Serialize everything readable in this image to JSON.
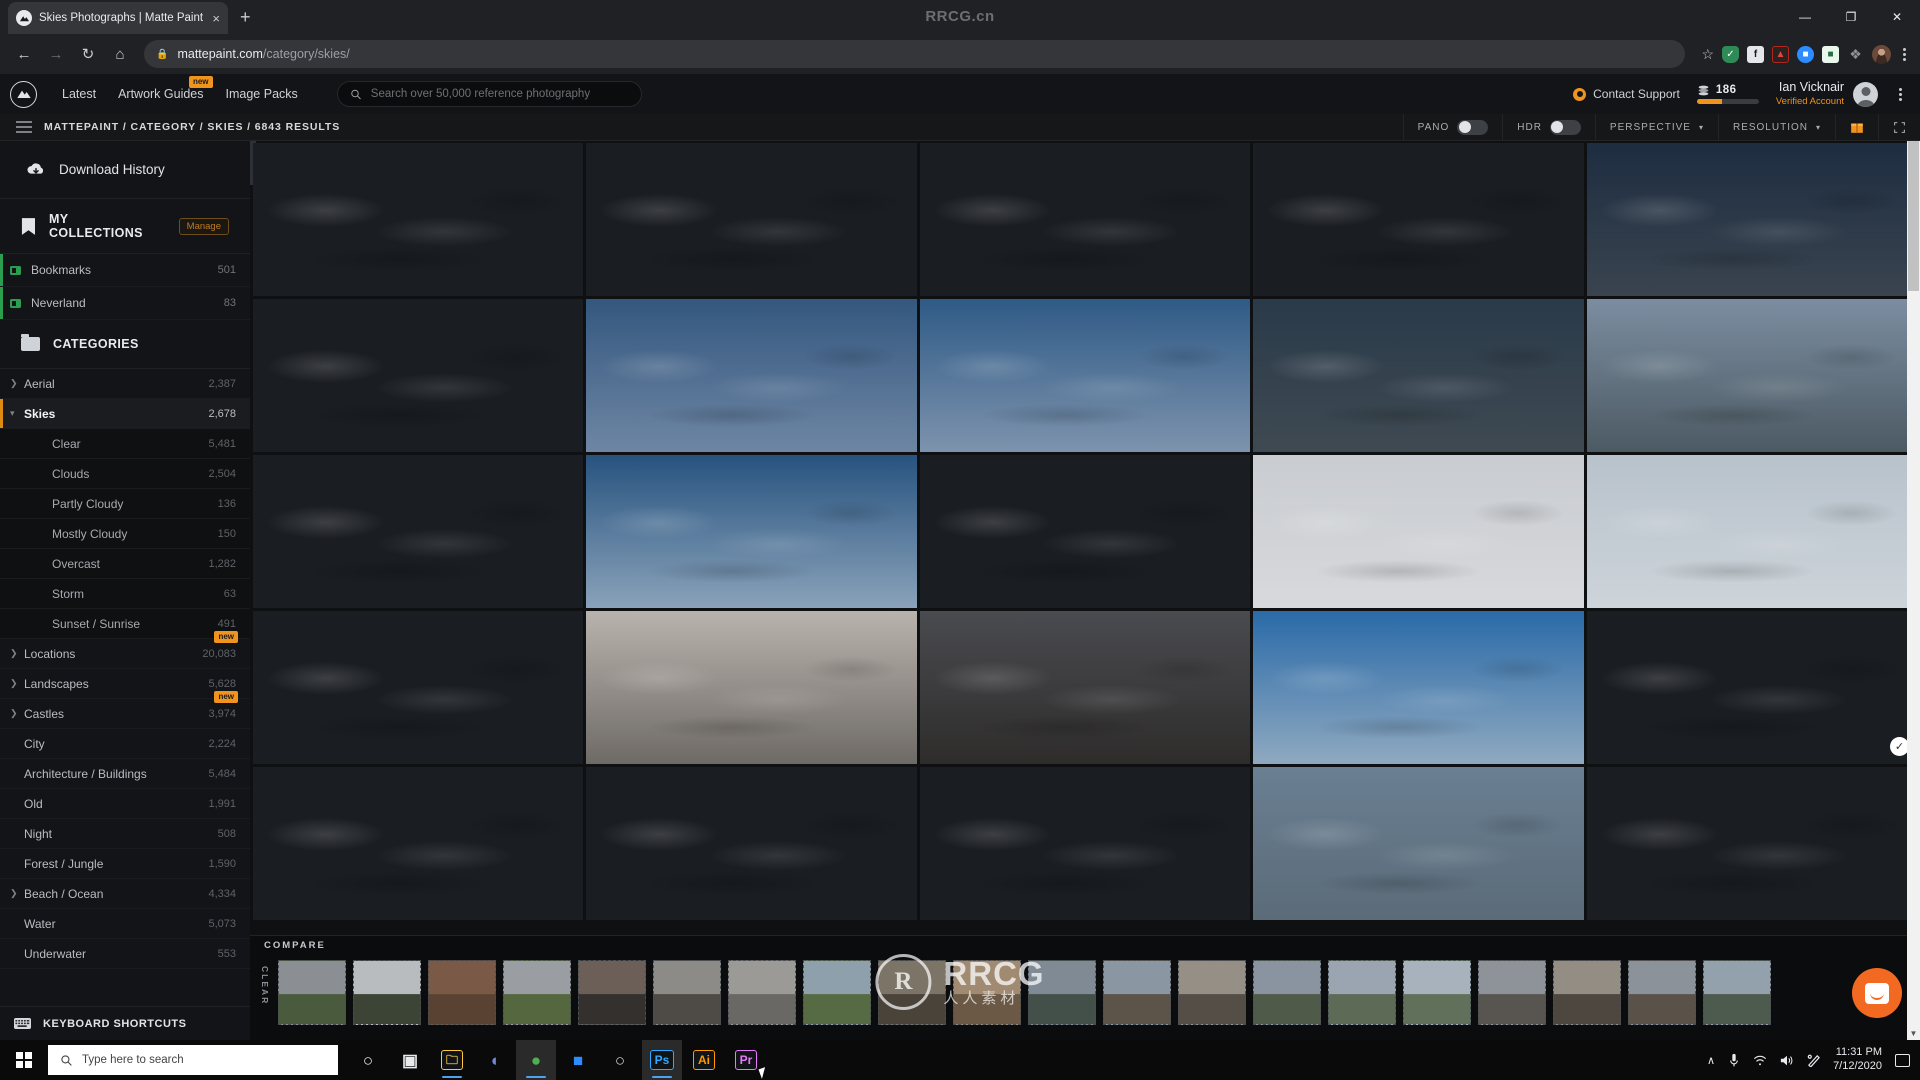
{
  "browser": {
    "tab": {
      "title": "Skies Photographs | Matte Paint",
      "favicon": "mattepaint-logo-icon",
      "close": "×"
    },
    "new_tab": "+",
    "window_watermark": "RRCG.cn",
    "window_controls": {
      "minimize": "—",
      "maximize": "❐",
      "close": "✕"
    },
    "nav": {
      "back": "←",
      "forward": "→",
      "reload": "↻",
      "home": "⌂"
    },
    "url": {
      "lock": "🔒",
      "domain": "mattepaint.com",
      "path": "/category/skies/"
    },
    "extensions": [
      {
        "name": "bookmark-star-icon",
        "glyph": "☆",
        "color": "transparent"
      },
      {
        "name": "vpn-shield-icon",
        "glyph": "✓",
        "color": "#2e8b57"
      },
      {
        "name": "facebook-icon",
        "glyph": "f",
        "color": "#e4e6eb"
      },
      {
        "name": "adobe-acrobat-icon",
        "glyph": "▲",
        "color": "#b3261e"
      },
      {
        "name": "zoom-icon",
        "glyph": "■",
        "color": "#2d8cff"
      },
      {
        "name": "evernote-icon",
        "glyph": "■",
        "color": "#e9f7ec"
      },
      {
        "name": "extensions-puzzle-icon",
        "glyph": "❖",
        "color": "#8e9196"
      },
      {
        "name": "chrome-profile-avatar",
        "glyph": "",
        "color": "#6b4a3a"
      }
    ],
    "menu": "⋮"
  },
  "site_header": {
    "logo": "mattepaint-mountain-logo",
    "nav_links": [
      {
        "label": "Latest",
        "badge": ""
      },
      {
        "label": "Artwork Guides",
        "badge": "new"
      },
      {
        "label": "Image Packs",
        "badge": ""
      }
    ],
    "search": {
      "placeholder": "Search over 50,000 reference photography",
      "value": "",
      "icon": "search-icon"
    },
    "support": {
      "label": "Contact Support",
      "icon": "lifering-icon"
    },
    "credits": {
      "count": "186",
      "icon": "credits-coins-icon",
      "progress_pct": 40
    },
    "user": {
      "name": "Ian Vicknair",
      "status": "Verified Account",
      "avatar": "user-avatar"
    },
    "more_menu": "⋮"
  },
  "toolbar": {
    "menu_icon": "hamburger-icon",
    "breadcrumb": "MATTEPAINT / CATEGORY / SKIES / 6843 RESULTS",
    "controls": [
      {
        "label": "PANO",
        "type": "toggle",
        "state": "off"
      },
      {
        "label": "HDR",
        "type": "toggle",
        "state": "off"
      },
      {
        "label": "PERSPECTIVE",
        "type": "dropdown",
        "caret": "▾"
      },
      {
        "label": "RESOLUTION",
        "type": "dropdown",
        "caret": "▾"
      }
    ],
    "gift_icon": "🎁",
    "fullscreen_icon": "⛶"
  },
  "sidebar": {
    "download_history": {
      "label": "Download History",
      "icon": "cloud-download-icon"
    },
    "collections": {
      "title": "MY COLLECTIONS",
      "icon": "bookmark-icon",
      "manage_label": "Manage",
      "items": [
        {
          "label": "Bookmarks",
          "count": "501"
        },
        {
          "label": "Neverland",
          "count": "83"
        }
      ]
    },
    "categories": {
      "title": "CATEGORIES",
      "icon": "folder-icon",
      "items": [
        {
          "label": "Aerial",
          "count": "2,387",
          "expandable": true,
          "expanded": false,
          "sub": false,
          "active": false,
          "badge": ""
        },
        {
          "label": "Skies",
          "count": "2,678",
          "expandable": true,
          "expanded": true,
          "sub": false,
          "active": true,
          "badge": ""
        },
        {
          "label": "Clear",
          "count": "5,481",
          "expandable": false,
          "expanded": false,
          "sub": true,
          "active": false,
          "badge": ""
        },
        {
          "label": "Clouds",
          "count": "2,504",
          "expandable": false,
          "expanded": false,
          "sub": true,
          "active": false,
          "badge": ""
        },
        {
          "label": "Partly Cloudy",
          "count": "136",
          "expandable": false,
          "expanded": false,
          "sub": true,
          "active": false,
          "badge": ""
        },
        {
          "label": "Mostly Cloudy",
          "count": "150",
          "expandable": false,
          "expanded": false,
          "sub": true,
          "active": false,
          "badge": ""
        },
        {
          "label": "Overcast",
          "count": "1,282",
          "expandable": false,
          "expanded": false,
          "sub": true,
          "active": false,
          "badge": ""
        },
        {
          "label": "Storm",
          "count": "63",
          "expandable": false,
          "expanded": false,
          "sub": true,
          "active": false,
          "badge": ""
        },
        {
          "label": "Sunset / Sunrise",
          "count": "491",
          "expandable": false,
          "expanded": false,
          "sub": true,
          "active": false,
          "badge": ""
        },
        {
          "label": "Locations",
          "count": "20,083",
          "expandable": true,
          "expanded": false,
          "sub": false,
          "active": false,
          "badge": "new"
        },
        {
          "label": "Landscapes",
          "count": "5,628",
          "expandable": true,
          "expanded": false,
          "sub": false,
          "active": false,
          "badge": ""
        },
        {
          "label": "Castles",
          "count": "3,974",
          "expandable": true,
          "expanded": false,
          "sub": false,
          "active": false,
          "badge": "new"
        },
        {
          "label": "City",
          "count": "2,224",
          "expandable": false,
          "expanded": false,
          "sub": false,
          "active": false,
          "badge": ""
        },
        {
          "label": "Architecture / Buildings",
          "count": "5,484",
          "expandable": false,
          "expanded": false,
          "sub": false,
          "active": false,
          "badge": ""
        },
        {
          "label": "Old",
          "count": "1,991",
          "expandable": false,
          "expanded": false,
          "sub": false,
          "active": false,
          "badge": ""
        },
        {
          "label": "Night",
          "count": "508",
          "expandable": false,
          "expanded": false,
          "sub": false,
          "active": false,
          "badge": ""
        },
        {
          "label": "Forest / Jungle",
          "count": "1,590",
          "expandable": false,
          "expanded": false,
          "sub": false,
          "active": false,
          "badge": ""
        },
        {
          "label": "Beach / Ocean",
          "count": "4,334",
          "expandable": true,
          "expanded": false,
          "sub": false,
          "active": false,
          "badge": ""
        },
        {
          "label": "Water",
          "count": "5,073",
          "expandable": false,
          "expanded": false,
          "sub": false,
          "active": false,
          "badge": ""
        },
        {
          "label": "Underwater",
          "count": "553",
          "expandable": false,
          "expanded": false,
          "sub": false,
          "active": false,
          "badge": ""
        }
      ]
    },
    "keyboard_shortcuts": {
      "label": "KEYBOARD SHORTCUTS",
      "icon": "keyboard-icon"
    }
  },
  "grid": {
    "columns": 5,
    "rows": 5,
    "selected_index": 19,
    "check_glyph": "✓",
    "scroll_down_glyph": "▼",
    "cells": [
      {
        "sky": "sunset-clouds-horizon-glow",
        "top": "#16304f",
        "bot": "#1d1b18",
        "sun": "50%,92%",
        "sunc": "#ffcb6e"
      },
      {
        "sky": "sunset-clouds-horizon-glow",
        "top": "#14304f",
        "bot": "#1a1916",
        "sun": "52%,93%",
        "sunc": "#ffc96a"
      },
      {
        "sky": "sunset-pink-clouds",
        "top": "#1a3352",
        "bot": "#241f1c",
        "sun": "48%,95%",
        "sunc": "#ffbb63"
      },
      {
        "sky": "dark-storm-clouds-dusk",
        "top": "#3d3a42",
        "bot": "#4a3c36",
        "sun": "60%,98%",
        "sunc": "#b08e72"
      },
      {
        "sky": "dark-clouds-blue-horizon",
        "top": "#1d2d40",
        "bot": "#3a4450",
        "sun": "",
        "sunc": ""
      },
      {
        "sky": "sunset-glow-low-clouds",
        "top": "#16324f",
        "bot": "#1c1a17",
        "sun": "40%,94%",
        "sunc": "#ffc35f"
      },
      {
        "sky": "blue-sky-wispy-clouds",
        "top": "#34577f",
        "bot": "#6e86a4",
        "sun": "",
        "sunc": ""
      },
      {
        "sky": "blue-sky-scattered-clouds",
        "top": "#2f5a86",
        "bot": "#7d93ad",
        "sun": "",
        "sunc": ""
      },
      {
        "sky": "dusk-heavy-clouds-hills",
        "top": "#2a3a4a",
        "bot": "#3f4a52",
        "sun": "",
        "sunc": ""
      },
      {
        "sky": "pale-clouds-over-hills",
        "top": "#7b8da0",
        "bot": "#4c5a63",
        "sun": "",
        "sunc": ""
      },
      {
        "sky": "dusk-gradient-horizon",
        "top": "#2a3549",
        "bot": "#3e3a34",
        "sun": "70%,96%",
        "sunc": "#c8a177"
      },
      {
        "sky": "blue-sky-thin-clouds",
        "top": "#27537f",
        "bot": "#8aa2ba",
        "sun": "",
        "sunc": ""
      },
      {
        "sky": "sunset-rays-low-sun",
        "top": "#1a3a5c",
        "bot": "#2a2420",
        "sun": "46%,90%",
        "sunc": "#ffc87a"
      },
      {
        "sky": "overcast-pale-white",
        "top": "#c9ccd0",
        "bot": "#d7d9dc",
        "sun": "",
        "sunc": ""
      },
      {
        "sky": "hazy-light-clouds",
        "top": "#b8c2cb",
        "bot": "#cdd4da",
        "sun": "",
        "sunc": ""
      },
      {
        "sky": "pale-sunrise-haze",
        "top": "#cfd2d4",
        "bot": "#bcb09c",
        "sun": "45%,88%",
        "sunc": "#f3e6c8"
      },
      {
        "sky": "sunrise-streak-clouds",
        "top": "#b9b3ad",
        "bot": "#6e6a66",
        "sun": "",
        "sunc": ""
      },
      {
        "sky": "dark-dramatic-clouds",
        "top": "#4a4b50",
        "bot": "#2e2c2b",
        "sun": "",
        "sunc": ""
      },
      {
        "sky": "blue-sky-cumulus-city",
        "top": "#2a6aa8",
        "bot": "#8fa9c0",
        "sun": "",
        "sunc": ""
      },
      {
        "sky": "bright-sun-cumulus",
        "top": "#3272ad",
        "bot": "#9cb4c8",
        "sun": "55%,35%",
        "sunc": "#ffffff"
      },
      {
        "sky": "blue-sky-bright-sun-clouds",
        "top": "#2f6ea9",
        "bot": "#b9cbd9",
        "sun": "52%,30%",
        "sunc": "#ffffff"
      },
      {
        "sky": "cumulus-clouds-blue",
        "top": "#2c6aa5",
        "bot": "#a9c0d2",
        "sun": "48%,42%",
        "sunc": "#f4f8fb"
      },
      {
        "sky": "white-clouds-sun-glare",
        "top": "#4d7fae",
        "bot": "#c8d6e0",
        "sun": "50%,38%",
        "sunc": "#ffffff"
      },
      {
        "sky": "power-lines-clouds",
        "top": "#6a7f93",
        "bot": "#5b6b78",
        "sun": "",
        "sunc": ""
      },
      {
        "sky": "bright-blue-sky-clouds",
        "top": "#2f74b2",
        "bot": "#cfdde8",
        "sun": "30%,25%",
        "sunc": "#ffffff"
      }
    ]
  },
  "compare": {
    "label": "COMPARE",
    "clear_label": "CLEAR",
    "thumbs": [
      {
        "name": "jacaranda-tree-field",
        "top": "#8b8e92",
        "bot": "#4a5a3c"
      },
      {
        "name": "trees-on-hill-overcast",
        "top": "#b9bcbf",
        "bot": "#3b4435"
      },
      {
        "name": "brick-building-facade",
        "top": "#7a5a46",
        "bot": "#5a4232"
      },
      {
        "name": "purple-tree-landscape",
        "top": "#9a9da1",
        "bot": "#55673f"
      },
      {
        "name": "dusk-horizon-field",
        "top": "#6b5f58",
        "bot": "#33302d"
      },
      {
        "name": "stone-column-ruin",
        "top": "#8d8b88",
        "bot": "#4e4b47"
      },
      {
        "name": "classical-building",
        "top": "#9b9a97",
        "bot": "#6a6865"
      },
      {
        "name": "grass-field-sky",
        "top": "#8fa0ad",
        "bot": "#566a44"
      },
      {
        "name": "old-wall-texture",
        "top": "#7d7468",
        "bot": "#4a4339"
      },
      {
        "name": "desert-rock-scene",
        "top": "#a08a72",
        "bot": "#6b5946"
      },
      {
        "name": "mountain-ridge",
        "top": "#7f8a95",
        "bot": "#43504a"
      },
      {
        "name": "castle-tower-sky",
        "top": "#8b96a3",
        "bot": "#5c5349"
      },
      {
        "name": "stone-arch-ruins",
        "top": "#958f86",
        "bot": "#544e46"
      },
      {
        "name": "hilltop-structure",
        "top": "#8a94a0",
        "bot": "#4f5a48"
      },
      {
        "name": "clouds-landscape",
        "top": "#9aa5b1",
        "bot": "#5d6a55"
      },
      {
        "name": "cloudy-sky-field",
        "top": "#a7b2bc",
        "bot": "#61705a"
      },
      {
        "name": "church-cathedral",
        "top": "#8e9399",
        "bot": "#585450"
      },
      {
        "name": "stone-gate-arch",
        "top": "#938d84",
        "bot": "#4d473f"
      },
      {
        "name": "village-houses",
        "top": "#8c929a",
        "bot": "#5a5249"
      },
      {
        "name": "coastal-cliff-view",
        "top": "#93a1ad",
        "bot": "#4d5a4e"
      }
    ]
  },
  "intercom": {
    "name": "intercom-chat-launcher"
  },
  "watermark": {
    "brand": "RRCG",
    "sub": "人人素材",
    "logo_letter": "R"
  },
  "taskbar": {
    "start": "start-button",
    "search_placeholder": "Type here to search",
    "apps": [
      {
        "name": "cortana-icon",
        "glyph": "○",
        "color": "#e8eaed",
        "running": false,
        "active": false
      },
      {
        "name": "task-view-icon",
        "glyph": "▣",
        "color": "#e8eaed",
        "running": false,
        "active": false
      },
      {
        "name": "file-explorer-icon",
        "glyph": "🗀",
        "color": "#ffc83d",
        "running": true,
        "active": false
      },
      {
        "name": "discord-icon",
        "glyph": "◖",
        "color": "#7289da",
        "running": false,
        "active": false
      },
      {
        "name": "chrome-icon",
        "glyph": "●",
        "color": "#4caf50",
        "running": true,
        "active": true
      },
      {
        "name": "zoom-icon",
        "glyph": "■",
        "color": "#2d8cff",
        "running": false,
        "active": false
      },
      {
        "name": "obs-studio-icon",
        "glyph": "○",
        "color": "#d4d4d4",
        "running": false,
        "active": false
      },
      {
        "name": "photoshop-icon",
        "glyph": "Ps",
        "color": "#31a8ff",
        "running": true,
        "active": true
      },
      {
        "name": "illustrator-icon",
        "glyph": "Ai",
        "color": "#ff9a00",
        "running": false,
        "active": false
      },
      {
        "name": "premiere-icon",
        "glyph": "Pr",
        "color": "#ea77ff",
        "running": false,
        "active": false
      }
    ],
    "tray": {
      "chevron": "∧",
      "mic": "mic-icon",
      "wifi": "wifi-icon",
      "volume": "volume-icon",
      "pen": "pen-icon"
    },
    "clock": {
      "time": "11:31 PM",
      "date": "7/12/2020"
    },
    "notifications": "notification-center-icon"
  }
}
